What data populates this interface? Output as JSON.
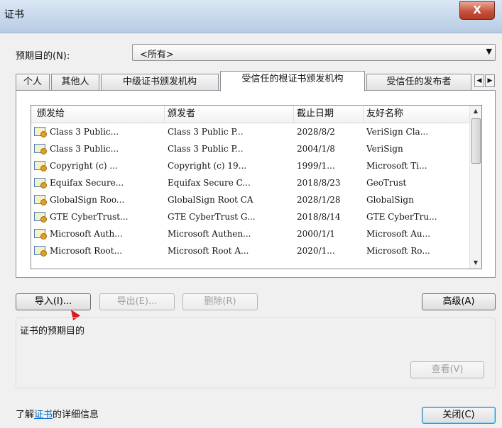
{
  "window": {
    "title": "证书",
    "close_glyph": "X"
  },
  "purpose": {
    "label": "预期目的(N):",
    "value": "<所有>"
  },
  "tabs": [
    {
      "label": "个人",
      "active": false
    },
    {
      "label": "其他人",
      "active": false
    },
    {
      "label": "中级证书颁发机构",
      "active": false
    },
    {
      "label": "受信任的根证书颁发机构",
      "active": true
    },
    {
      "label": "受信任的发布者",
      "active": false
    }
  ],
  "table": {
    "columns": [
      "颁发给",
      "颁发者",
      "截止日期",
      "友好名称"
    ],
    "rows": [
      {
        "issued_to": "Class 3 Public...",
        "issued_by": "Class 3 Public P...",
        "expires": "2028/8/2",
        "friendly": "VeriSign Cla..."
      },
      {
        "issued_to": "Class 3 Public...",
        "issued_by": "Class 3 Public P...",
        "expires": "2004/1/8",
        "friendly": "VeriSign"
      },
      {
        "issued_to": "Copyright (c) ...",
        "issued_by": "Copyright (c) 19...",
        "expires": "1999/1...",
        "friendly": "Microsoft Ti..."
      },
      {
        "issued_to": "Equifax Secure...",
        "issued_by": "Equifax Secure C...",
        "expires": "2018/8/23",
        "friendly": "GeoTrust"
      },
      {
        "issued_to": "GlobalSign Roo...",
        "issued_by": "GlobalSign Root CA",
        "expires": "2028/1/28",
        "friendly": "GlobalSign"
      },
      {
        "issued_to": "GTE CyberTrust...",
        "issued_by": "GTE CyberTrust G...",
        "expires": "2018/8/14",
        "friendly": "GTE CyberTru..."
      },
      {
        "issued_to": "Microsoft Auth...",
        "issued_by": "Microsoft Authen...",
        "expires": "2000/1/1",
        "friendly": "Microsoft Au..."
      },
      {
        "issued_to": "Microsoft Root...",
        "issued_by": "Microsoft Root A...",
        "expires": "2020/1...",
        "friendly": "Microsoft Ro..."
      }
    ]
  },
  "buttons": {
    "import": "导入(I)...",
    "export": "导出(E)...",
    "remove": "删除(R)",
    "advanced": "高级(A)",
    "view": "查看(V)",
    "close": "关闭(C)"
  },
  "purposes_group": {
    "label": "证书的预期目的"
  },
  "footer": {
    "prefix": "了解",
    "link": "证书",
    "suffix": "的详细信息"
  }
}
